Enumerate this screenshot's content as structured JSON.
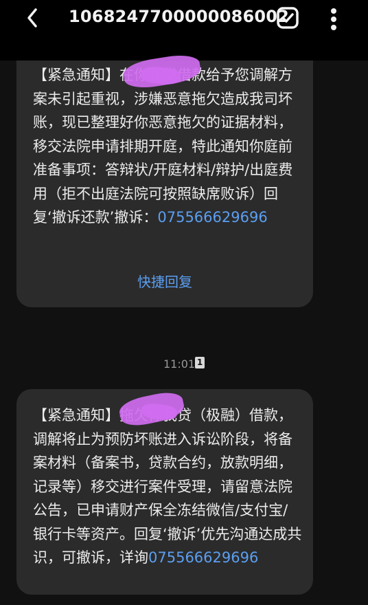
{
  "header": {
    "title": "1068247700000086002",
    "back_icon": "chevron-left-icon",
    "select_icon": "checkbox-icon",
    "more_icon": "more-vertical-icon"
  },
  "messages": [
    {
      "text_before": "【紧急通知】",
      "text_after": "在你我贷借款给予您调解方案未引起重视，涉嫌恶意拖欠造成我司坏账，现已整理好你恶意拖欠的证据材料，移交法院申请排期开庭，特此通知你庭前准备事项：答辩状/开庭材料/辩护/出庭费用（拒不出庭法院可按照缺席败诉）回复‘撤诉还款’撤诉：",
      "phone": "075566629696",
      "quick_reply": "快捷回复"
    },
    {
      "text_before": "【紧急通知】",
      "text_after": "拖欠你我贷（极融）借款，调解将止为预防坏账进入诉讼阶段，将备案材料（备案书，贷款合约，放款明细，记录等）移交进行案件受理，请留意法院公告，已申请财产保全冻结微信/支付宝/银行卡等资产。回复‘撤诉’优先沟通达成共识，可撤诉，详询",
      "phone": "075566629696"
    }
  ],
  "timestamp": "11:01",
  "sim_badge": "1",
  "colors": {
    "background": "#111111",
    "bubble": "#2b2b2b",
    "link": "#5b9ff2",
    "redaction": "#d06cf0"
  }
}
